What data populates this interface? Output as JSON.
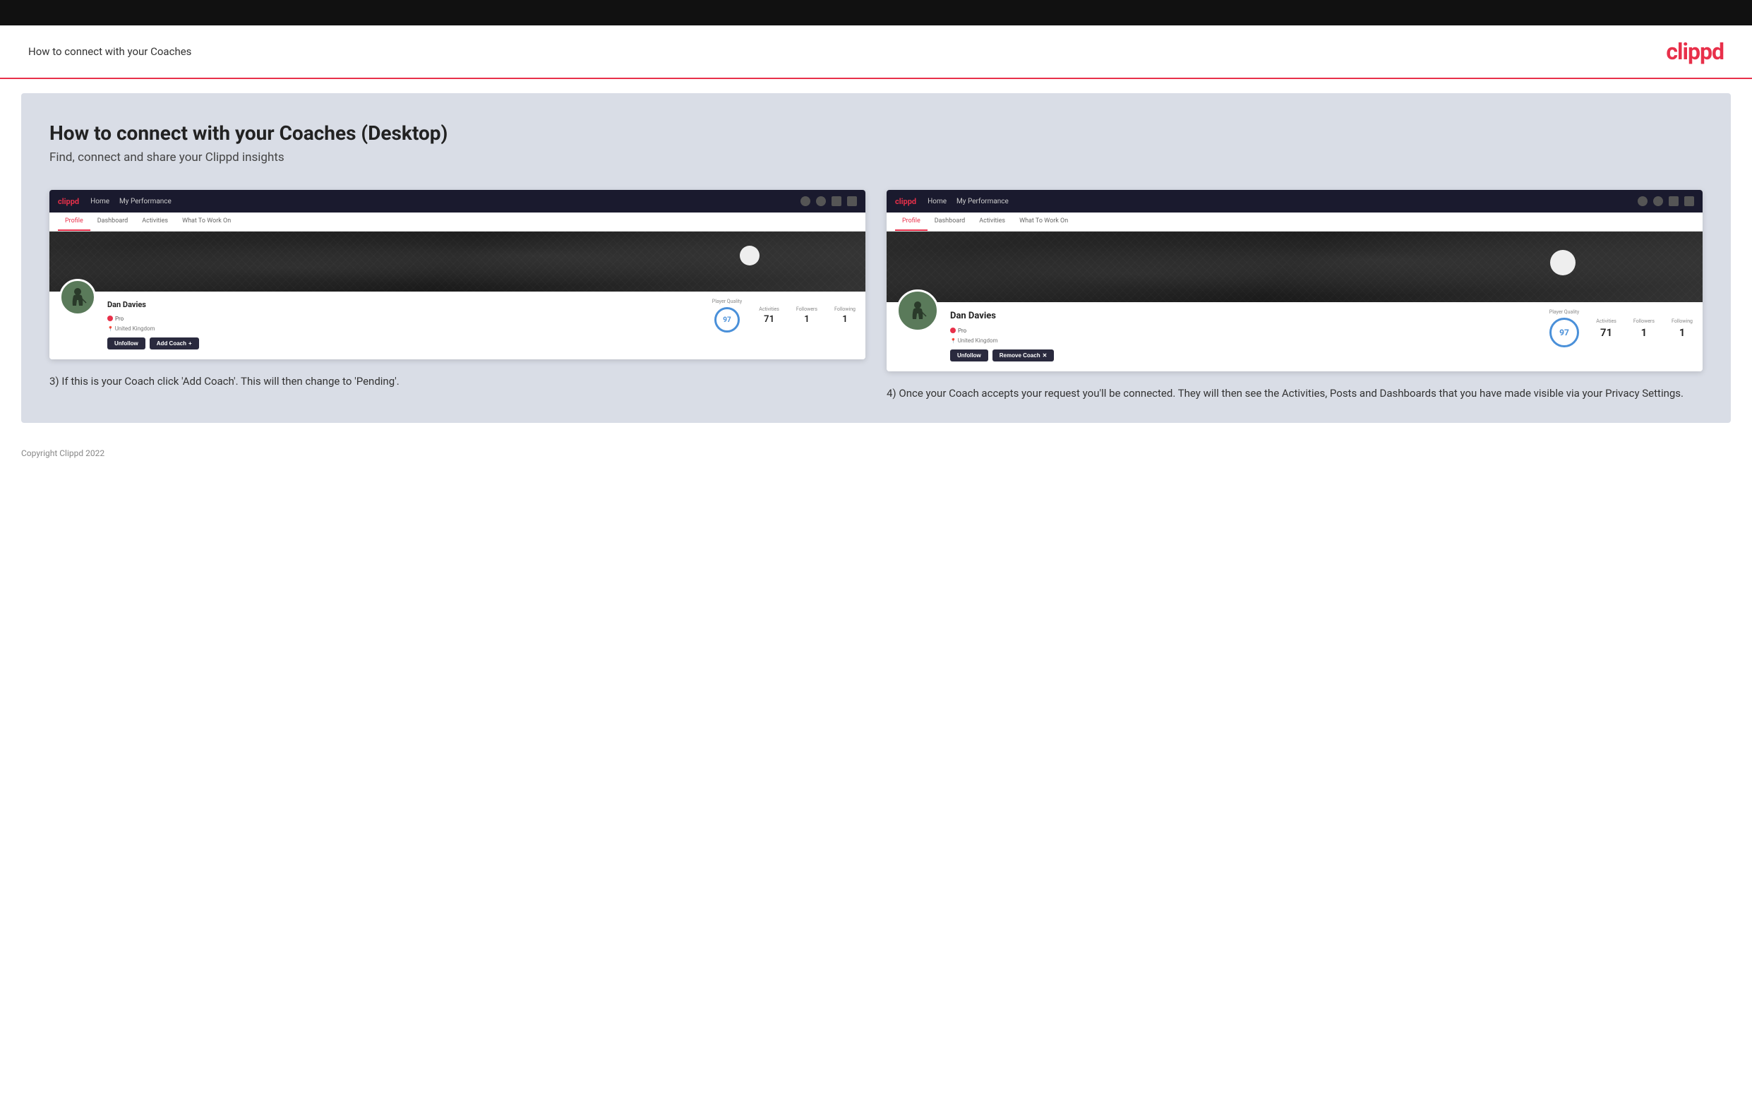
{
  "topbar": {},
  "header": {
    "title": "How to connect with your Coaches",
    "logo": "clippd"
  },
  "main": {
    "title": "How to connect with your Coaches (Desktop)",
    "subtitle": "Find, connect and share your Clippd insights",
    "left_panel": {
      "nav": {
        "logo": "clippd",
        "items": [
          "Home",
          "My Performance"
        ],
        "tabs": [
          "Profile",
          "Dashboard",
          "Activities",
          "What To Work On"
        ]
      },
      "profile": {
        "name": "Dan Davies",
        "badge": "Pro",
        "location": "United Kingdom",
        "player_quality_label": "Player Quality",
        "player_quality_value": "97",
        "activities_label": "Activities",
        "activities_value": "71",
        "followers_label": "Followers",
        "followers_value": "1",
        "following_label": "Following",
        "following_value": "1",
        "btn_unfollow": "Unfollow",
        "btn_add_coach": "Add Coach"
      },
      "description": "3) If this is your Coach click 'Add Coach'. This will then change to 'Pending'."
    },
    "right_panel": {
      "nav": {
        "logo": "clippd",
        "items": [
          "Home",
          "My Performance"
        ],
        "tabs": [
          "Profile",
          "Dashboard",
          "Activities",
          "What To Work On"
        ]
      },
      "profile": {
        "name": "Dan Davies",
        "badge": "Pro",
        "location": "United Kingdom",
        "player_quality_label": "Player Quality",
        "player_quality_value": "97",
        "activities_label": "Activities",
        "activities_value": "71",
        "followers_label": "Followers",
        "followers_value": "1",
        "following_label": "Following",
        "following_value": "1",
        "btn_unfollow": "Unfollow",
        "btn_remove_coach": "Remove Coach"
      },
      "description": "4) Once your Coach accepts your request you'll be connected. They will then see the Activities, Posts and Dashboards that you have made visible via your Privacy Settings."
    }
  },
  "footer": {
    "copyright": "Copyright Clippd 2022"
  }
}
